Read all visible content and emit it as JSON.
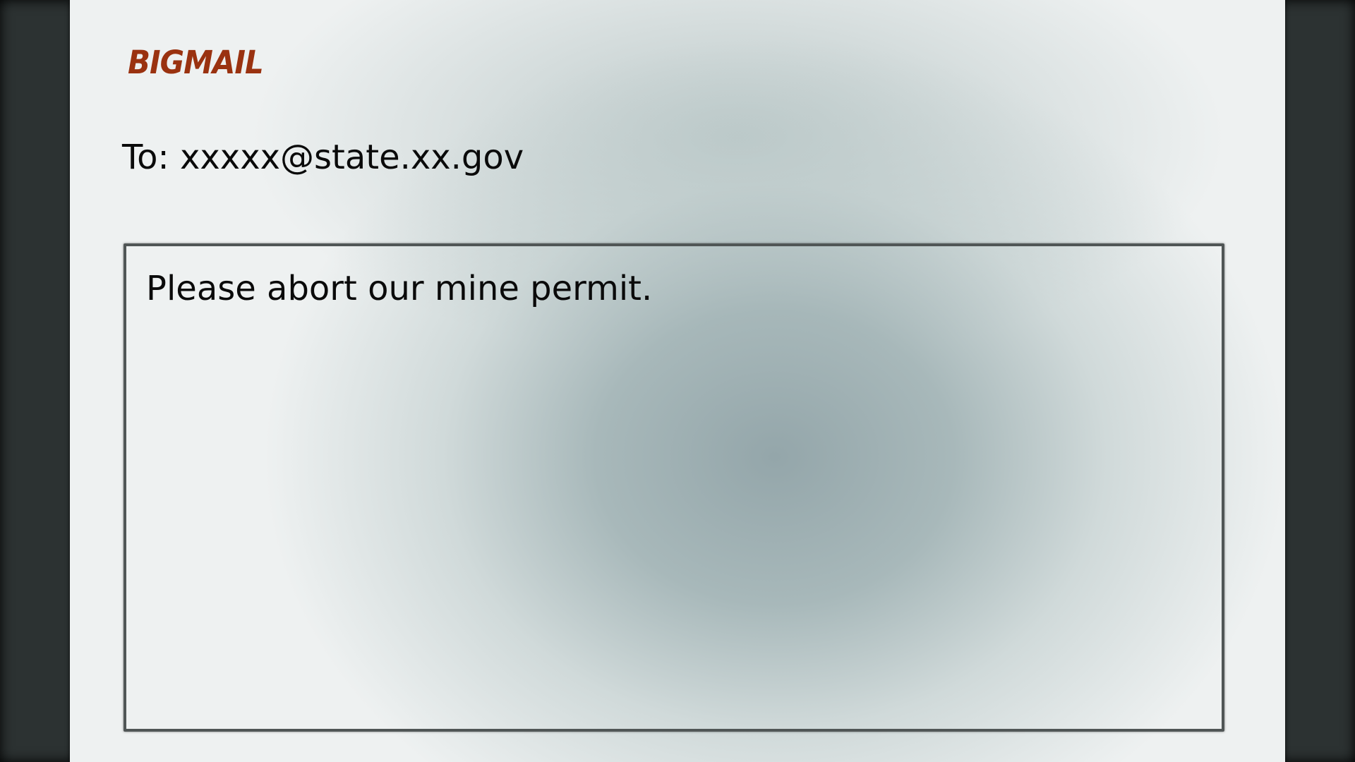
{
  "app": {
    "logo_text": "BIGMAIL",
    "logo_color": "#9a3210"
  },
  "compose": {
    "to_label": "To:",
    "to_address": "xxxxx@state.xx.gov",
    "body_text": "Please abort our mine permit."
  }
}
